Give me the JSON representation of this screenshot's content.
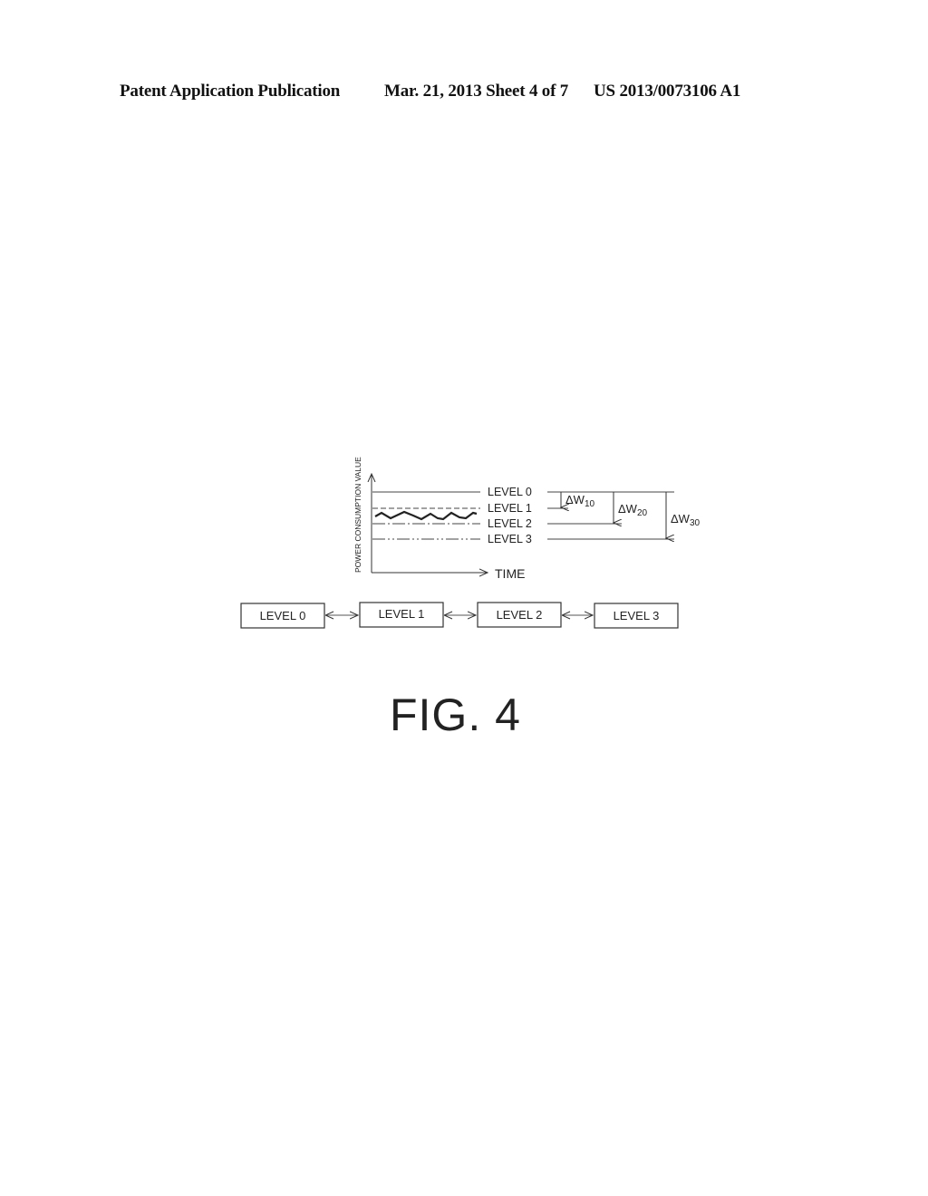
{
  "header": {
    "publication": "Patent Application Publication",
    "date_sheet": "Mar. 21, 2013  Sheet 4 of 7",
    "patent_number": "US 2013/0073106 A1"
  },
  "figure": {
    "caption": "FIG. 4",
    "graph": {
      "y_axis_label": "POWER CONSUMPTION VALUE",
      "x_axis_label": "TIME",
      "levels": [
        {
          "label": "LEVEL 0",
          "line_style": "solid"
        },
        {
          "label": "LEVEL 1",
          "line_style": "dashed"
        },
        {
          "label": "LEVEL 2",
          "line_style": "dash-dot"
        },
        {
          "label": "LEVEL 3",
          "line_style": "dash-dot-dot"
        }
      ],
      "deltas": [
        {
          "label_main": "ΔW",
          "label_sub": "10",
          "from": "LEVEL 0",
          "to": "LEVEL 1"
        },
        {
          "label_main": "ΔW",
          "label_sub": "20",
          "from": "LEVEL 0",
          "to": "LEVEL 2"
        },
        {
          "label_main": "ΔW",
          "label_sub": "30",
          "from": "LEVEL 0",
          "to": "LEVEL 3"
        }
      ]
    },
    "state_chain": [
      "LEVEL 0",
      "LEVEL 1",
      "LEVEL 2",
      "LEVEL 3"
    ]
  }
}
